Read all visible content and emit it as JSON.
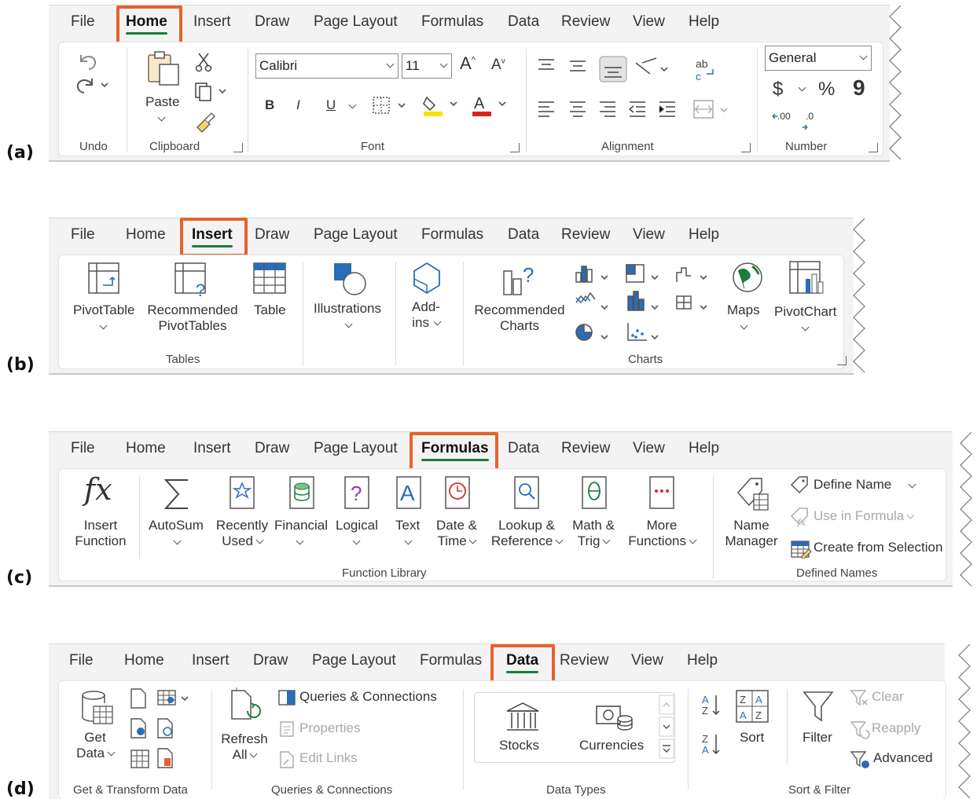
{
  "panels": [
    {
      "label": "(a)"
    },
    {
      "label": "(b)"
    },
    {
      "label": "(c)"
    },
    {
      "label": "(d)"
    }
  ],
  "tabs_a": [
    "File",
    "Home",
    "Insert",
    "Draw",
    "Page Layout",
    "Formulas",
    "Data",
    "Review",
    "View",
    "Help"
  ],
  "tabs_d": [
    "File",
    "Home",
    "Insert",
    "Draw",
    "Page Layout",
    "Formulas",
    "Data",
    "Review",
    "View",
    "Help"
  ],
  "home": {
    "groups": {
      "undo": "Undo",
      "clipboard": "Clipboard",
      "font": "Font",
      "alignment": "Alignment",
      "number": "Number"
    },
    "paste": "Paste",
    "font_name": "Calibri",
    "font_size": "11",
    "bold": "B",
    "italic": "I",
    "underline": "U",
    "number_format": "General",
    "currency": "$",
    "percent": "%",
    "comma": "9",
    "inc_decimal": ".00",
    "dec_decimal": ".0"
  },
  "insert": {
    "groups": {
      "tables": "Tables",
      "charts": "Charts"
    },
    "pivottable": "PivotTable",
    "recommended_pivot": [
      "Recommended",
      "PivotTables"
    ],
    "table": "Table",
    "illustrations": "Illustrations",
    "addins": [
      "Add-",
      "ins"
    ],
    "recommended_charts": [
      "Recommended",
      "Charts"
    ],
    "maps": "Maps",
    "pivotchart": "PivotChart"
  },
  "formulas": {
    "groups": {
      "function_library": "Function Library",
      "defined_names": "Defined Names"
    },
    "insert_function": [
      "Insert",
      "Function"
    ],
    "autosum": "AutoSum",
    "recently_used": [
      "Recently",
      "Used"
    ],
    "financial": "Financial",
    "logical": "Logical",
    "text": "Text",
    "datetime": [
      "Date &",
      "Time"
    ],
    "lookup": [
      "Lookup &",
      "Reference"
    ],
    "mathtrig": [
      "Math &",
      "Trig"
    ],
    "more": [
      "More",
      "Functions"
    ],
    "name_manager": [
      "Name",
      "Manager"
    ],
    "define_name": "Define Name",
    "use_in_formula": "Use in Formula",
    "create_from_selection": "Create from Selection",
    "fx": "fx"
  },
  "data": {
    "groups": {
      "get_transform": "Get & Transform Data",
      "queries": "Queries & Connections",
      "data_types": "Data Types",
      "sort_filter": "Sort & Filter"
    },
    "get_data": [
      "Get",
      "Data"
    ],
    "refresh_all": [
      "Refresh",
      "All"
    ],
    "queries_connections": "Queries & Connections",
    "properties": "Properties",
    "edit_links": "Edit Links",
    "stocks": "Stocks",
    "currencies": "Currencies",
    "sort": "Sort",
    "filter": "Filter",
    "clear": "Clear",
    "reapply": "Reapply",
    "advanced": "Advanced"
  },
  "colors": {
    "highlight": "#e4632d",
    "active_underline": "#1a7d3c",
    "excel_green": "#1a7d3c",
    "font_color_red": "#e02020",
    "highlight_yellow": "#f2e600",
    "icon_blue": "#2b6cb8"
  }
}
